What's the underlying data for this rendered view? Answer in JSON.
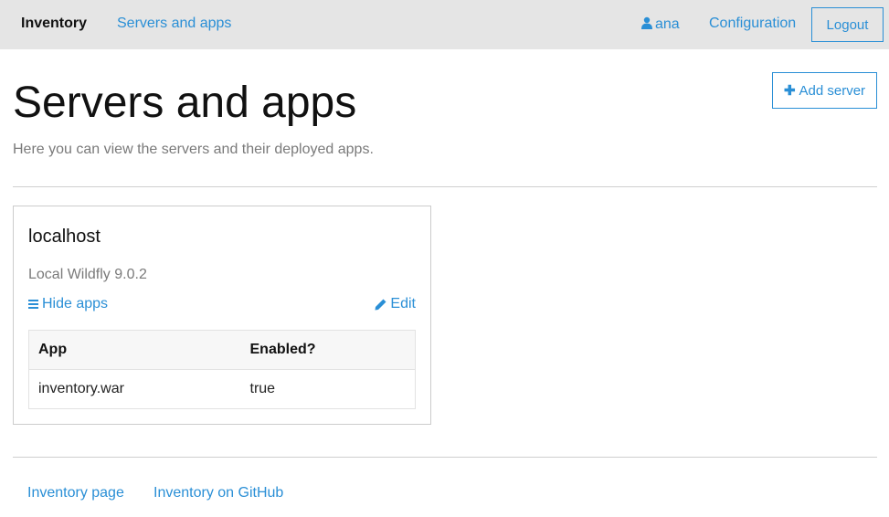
{
  "navbar": {
    "brand": "Inventory",
    "servers_link": "Servers and apps",
    "user_name": "ana",
    "configuration_link": "Configuration",
    "logout_label": "Logout"
  },
  "header": {
    "title": "Servers and apps",
    "subtitle": "Here you can view the servers and their deployed apps.",
    "add_server_label": "Add server"
  },
  "servers": [
    {
      "name": "localhost",
      "description": "Local Wildfly 9.0.2",
      "hide_apps_label": "Hide apps",
      "edit_label": "Edit",
      "table": {
        "columns": [
          "App",
          "Enabled?"
        ],
        "rows": [
          [
            "inventory.war",
            "true"
          ]
        ]
      }
    }
  ],
  "footer": {
    "links": [
      "Inventory page",
      "Inventory on GitHub"
    ]
  },
  "colors": {
    "accent": "#2a8fd6",
    "navbar_bg": "#e5e5e5",
    "muted_text": "#7a7a7a"
  },
  "icons": {
    "user": "user-icon",
    "plus": "plus-icon",
    "bars": "bars-icon",
    "pencil": "pencil-icon"
  }
}
